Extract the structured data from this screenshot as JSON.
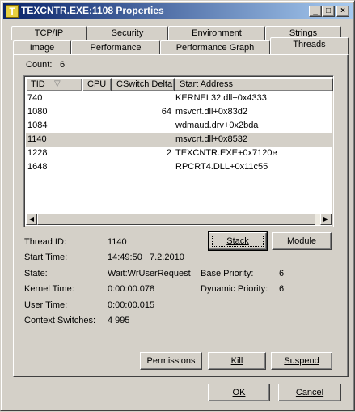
{
  "window": {
    "title": "TEXCNTR.EXE:1108 Properties",
    "icon_letter": "T",
    "controls": {
      "minimize": "_",
      "maximize": "□",
      "close": "×"
    }
  },
  "tabs_back": [
    "TCP/IP",
    "Security",
    "Environment",
    "Strings"
  ],
  "tabs_front": [
    "Image",
    "Performance",
    "Performance Graph",
    "Threads"
  ],
  "active_tab": "Threads",
  "count": {
    "label": "Count:",
    "value": "6"
  },
  "threads_table": {
    "columns": [
      "TID",
      "CPU",
      "CSwitch Delta",
      "Start Address"
    ],
    "sort_indicator": "▽",
    "rows": [
      {
        "tid": "740",
        "cpu": "",
        "cswitch": "",
        "start": "KERNEL32.dll+0x4333"
      },
      {
        "tid": "1080",
        "cpu": "",
        "cswitch": "64",
        "start": "msvcrt.dll+0x83d2"
      },
      {
        "tid": "1084",
        "cpu": "",
        "cswitch": "",
        "start": "wdmaud.drv+0x2bda"
      },
      {
        "tid": "1140",
        "cpu": "",
        "cswitch": "",
        "start": "msvcrt.dll+0x8532"
      },
      {
        "tid": "1228",
        "cpu": "",
        "cswitch": "2",
        "start": "TEXCNTR.EXE+0x7120e"
      },
      {
        "tid": "1648",
        "cpu": "",
        "cswitch": "",
        "start": "RPCRT4.DLL+0x11c55"
      }
    ],
    "selected_tid": "1140"
  },
  "details": {
    "thread_id": {
      "label": "Thread ID:",
      "value": "1140"
    },
    "start_time": {
      "label": "Start Time:",
      "value": "14:49:50   7.2.2010"
    },
    "state": {
      "label": "State:",
      "value": "Wait:WrUserRequest"
    },
    "base_priority": {
      "label": "Base Priority:",
      "value": "6"
    },
    "kernel_time": {
      "label": "Kernel Time:",
      "value": "0:00:00.078"
    },
    "dynamic_priority": {
      "label": "Dynamic Priority:",
      "value": "6"
    },
    "user_time": {
      "label": "User Time:",
      "value": "0:00:00.015"
    },
    "context_switches": {
      "label": "Context Switches:",
      "value": "4 995"
    }
  },
  "buttons": {
    "stack": "Stack",
    "module": "Module",
    "permissions": "Permissions",
    "kill": "Kill",
    "suspend": "Suspend",
    "ok": "OK",
    "cancel": "Cancel"
  }
}
